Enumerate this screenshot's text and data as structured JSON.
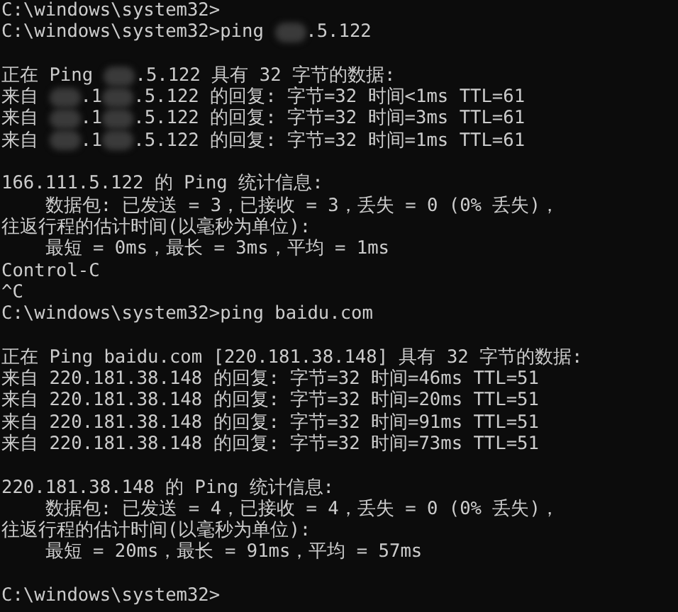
{
  "console": {
    "lines": [
      {
        "kind": "text",
        "text": "C:\\windows\\system32>"
      },
      {
        "kind": "redacted",
        "parts": [
          "C:\\windows\\system32>ping ",
          ".5.122"
        ]
      },
      {
        "kind": "blank"
      },
      {
        "kind": "redacted",
        "parts": [
          "正在 Ping ",
          ".5.122 具有 32 字节的数据:"
        ]
      },
      {
        "kind": "redacted",
        "parts": [
          "来自 ",
          ".1",
          ".5.122 的回复: 字节=32 时间<1ms TTL=61"
        ]
      },
      {
        "kind": "redacted",
        "parts": [
          "来自 ",
          ".1",
          ".5.122 的回复: 字节=32 时间=3ms TTL=61"
        ]
      },
      {
        "kind": "redacted",
        "parts": [
          "来自 ",
          ".1",
          ".5.122 的回复: 字节=32 时间=1ms TTL=61"
        ]
      },
      {
        "kind": "blank"
      },
      {
        "kind": "text",
        "text": "166.111.5.122 的 Ping 统计信息:"
      },
      {
        "kind": "text",
        "text": "    数据包: 已发送 = 3，已接收 = 3，丢失 = 0 (0% 丢失)，"
      },
      {
        "kind": "text",
        "text": "往返行程的估计时间(以毫秒为单位):"
      },
      {
        "kind": "text",
        "text": "    最短 = 0ms，最长 = 3ms，平均 = 1ms"
      },
      {
        "kind": "text",
        "text": "Control-C"
      },
      {
        "kind": "text",
        "text": "^C"
      },
      {
        "kind": "text",
        "text": "C:\\windows\\system32>ping baidu.com"
      },
      {
        "kind": "blank"
      },
      {
        "kind": "text",
        "text": "正在 Ping baidu.com [220.181.38.148] 具有 32 字节的数据:"
      },
      {
        "kind": "text",
        "text": "来自 220.181.38.148 的回复: 字节=32 时间=46ms TTL=51"
      },
      {
        "kind": "text",
        "text": "来自 220.181.38.148 的回复: 字节=32 时间=20ms TTL=51"
      },
      {
        "kind": "text",
        "text": "来自 220.181.38.148 的回复: 字节=32 时间=91ms TTL=51"
      },
      {
        "kind": "text",
        "text": "来自 220.181.38.148 的回复: 字节=32 时间=73ms TTL=51"
      },
      {
        "kind": "blank"
      },
      {
        "kind": "text",
        "text": "220.181.38.148 的 Ping 统计信息:"
      },
      {
        "kind": "text",
        "text": "    数据包: 已发送 = 4，已接收 = 4，丢失 = 0 (0% 丢失)，"
      },
      {
        "kind": "text",
        "text": "往返行程的估计时间(以毫秒为单位):"
      },
      {
        "kind": "text",
        "text": "    最短 = 20ms，最长 = 91ms，平均 = 57ms"
      },
      {
        "kind": "blank"
      },
      {
        "kind": "text",
        "text": "C:\\windows\\system32>"
      }
    ]
  }
}
